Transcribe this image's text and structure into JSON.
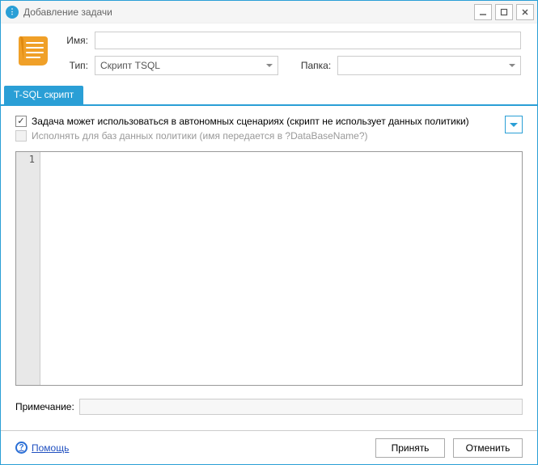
{
  "window": {
    "title": "Добавление задачи",
    "app_icon": "app-icon"
  },
  "form": {
    "name_label": "Имя:",
    "name_value": "",
    "type_label": "Тип:",
    "type_value": "Скрипт TSQL",
    "folder_label": "Папка:",
    "folder_value": ""
  },
  "tabs": [
    {
      "label": "T-SQL скрипт",
      "active": true
    }
  ],
  "options": {
    "autonomous": {
      "checked": true,
      "label": "Задача может использоваться в автономных сценариях (скрипт не использует данных политики)"
    },
    "run_for_db": {
      "checked": false,
      "enabled": false,
      "label": "Исполнять для баз данных политики (имя передается в ?DataBaseName?)"
    }
  },
  "editor": {
    "line_start": "1",
    "content": ""
  },
  "note": {
    "label": "Примечание:",
    "value": ""
  },
  "footer": {
    "help": "Помощь",
    "ok": "Принять",
    "cancel": "Отменить"
  }
}
